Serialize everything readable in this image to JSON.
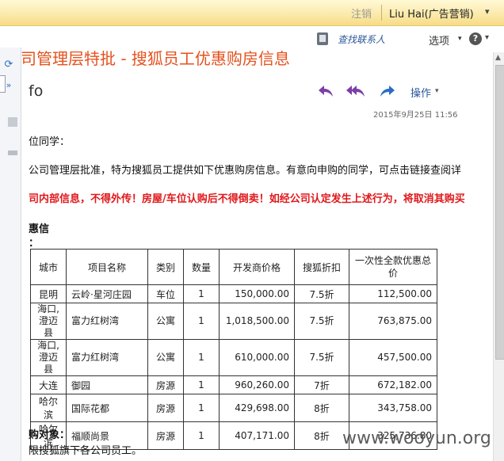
{
  "topbar": {
    "signout": "注销",
    "user": "Liu Hai(广告营销)",
    "caret": "▾"
  },
  "toolbar": {
    "find_contacts": "查找联系人",
    "options": "选项",
    "options_caret": "▾",
    "help": "?",
    "help_caret": "▾"
  },
  "message": {
    "subject": "司管理层特批 - 搜狐员工优惠购房信息",
    "title": "fo",
    "actions_label": "操作",
    "actions_caret": "▾",
    "timestamp": "2015年9月25日  11:56",
    "greeting": "位同学：",
    "intro": "公司管理层批准，特为搜狐员工提供如下优惠购房信息。有意向申购的同学，可点击链接查阅详",
    "warning": "司内部信息，不得外传！房屋/车位认购后不得倒卖！如经公司认定发生上述行为，将取消其购买",
    "section_heading": "惠信",
    "section_sub": "：",
    "footer_heading": "购对象：",
    "footer_text": "限搜狐旗下各公司员工。"
  },
  "table": {
    "headers": [
      "城市",
      "项目名称",
      "类别",
      "数量",
      "开发商价格",
      "搜狐折扣",
      "一次性全款优惠总价"
    ],
    "rows": [
      [
        "昆明",
        "云岭·星河庄园",
        "车位",
        "1",
        "150,000.00",
        "7.5折",
        "112,500.00"
      ],
      [
        "海口,澄迈县",
        "富力红树湾",
        "公寓",
        "1",
        "1,018,500.00",
        "7.5折",
        "763,875.00"
      ],
      [
        "海口,澄迈县",
        "富力红树湾",
        "公寓",
        "1",
        "610,000.00",
        "7.5折",
        "457,500.00"
      ],
      [
        "大连",
        "御园",
        "房源",
        "1",
        "960,260.00",
        "7折",
        "672,182.00"
      ],
      [
        "哈尔滨",
        "国际花都",
        "房源",
        "1",
        "429,698.00",
        "8折",
        "343,758.00"
      ],
      [
        "哈尔滨",
        "福顺尚景",
        "房源",
        "1",
        "407,171.00",
        "8折",
        "325,736.80"
      ]
    ]
  },
  "watermark": "www.wooyun.org",
  "icons": {
    "refresh": "refresh-icon",
    "expand": "double-chevron-icon",
    "reply": "reply-icon",
    "reply_all": "reply-all-icon",
    "forward": "forward-icon"
  },
  "colors": {
    "subject": "#e5511d",
    "warning": "#e0181b",
    "link": "#2b579a",
    "reply": "#7a3fa8",
    "forward": "#2b6cc4"
  }
}
